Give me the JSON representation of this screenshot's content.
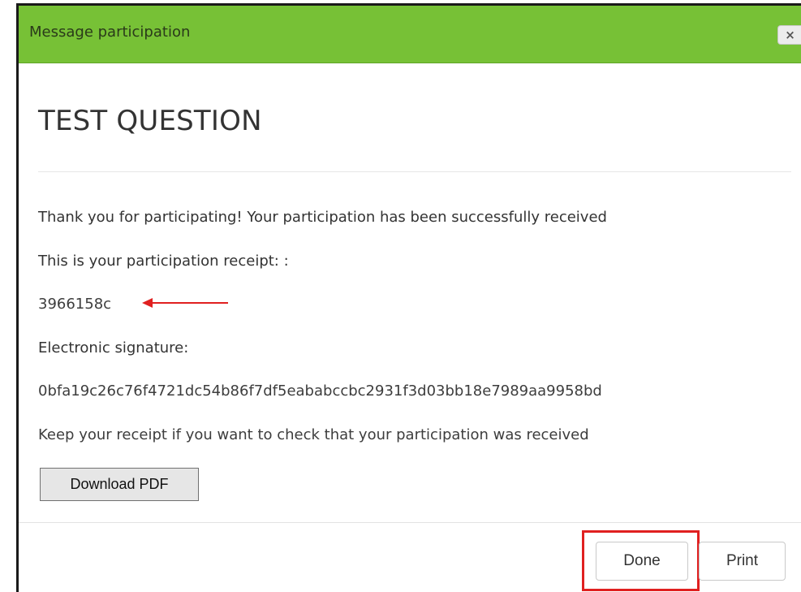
{
  "dialog": {
    "title": "Message participation",
    "close_label": "×",
    "heading": "TEST QUESTION",
    "thank_you": "Thank you for participating! Your participation has been successfully received",
    "receipt_label": "This is your participation receipt: :",
    "receipt_code": "3966158c",
    "signature_label": "Electronic signature:",
    "signature_value": "0bfa19c26c76f4721dc54b86f7df5eababccbc2931f3d03bb18e7989aa9958bd",
    "keep_note": "Keep your receipt if you want to check that your participation was received",
    "download_pdf_label": "Download PDF"
  },
  "footer": {
    "done_label": "Done",
    "print_label": "Print"
  },
  "colors": {
    "header_green": "#77c136",
    "annotation_red": "#e02020"
  },
  "icons": {
    "close": "close-icon",
    "arrow": "arrow-left-icon"
  }
}
